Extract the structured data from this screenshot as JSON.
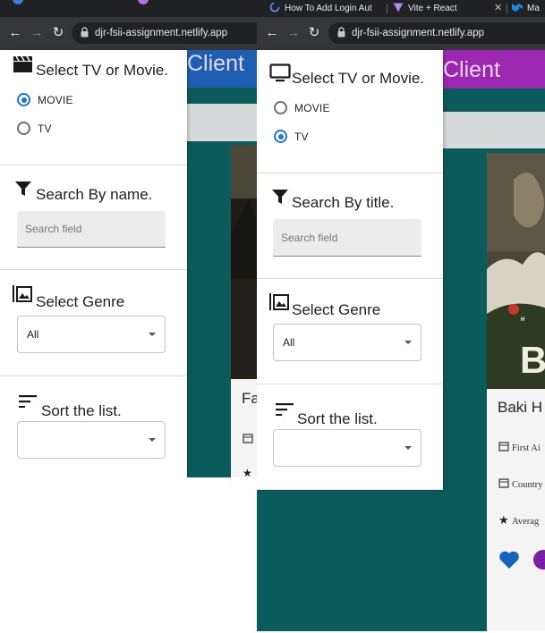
{
  "left_window": {
    "url": "djr-fsii-assignment.netlify.app",
    "app_title": "Client",
    "drawer": {
      "type_section": {
        "title": "Select TV or Movie.",
        "options": [
          "MOVIE",
          "TV"
        ],
        "selected": "MOVIE"
      },
      "search_section": {
        "title": "Search By name.",
        "placeholder": "Search field"
      },
      "genre_section": {
        "title": "Select Genre",
        "value": "All"
      },
      "sort_section": {
        "title": "Sort the list.",
        "value": ""
      }
    },
    "card": {
      "title_fragment": "Fa"
    }
  },
  "right_window": {
    "tabs": [
      {
        "title": "How To Add Login Aut"
      },
      {
        "title": "Vite + React"
      },
      {
        "title": "Ma"
      }
    ],
    "url": "djr-fsii-assignment.netlify.app",
    "app_title": "Client",
    "drawer": {
      "type_section": {
        "title": "Select TV or Movie.",
        "options": [
          "MOVIE",
          "TV"
        ],
        "selected": "TV"
      },
      "search_section": {
        "title": "Search By title.",
        "placeholder": "Search field"
      },
      "genre_section": {
        "title": "Select Genre",
        "value": "All"
      },
      "sort_section": {
        "title": "Sort the list.",
        "value": ""
      }
    },
    "card": {
      "title": "Baki H",
      "poster_text": "B",
      "poster_small_text": "H",
      "lines": [
        "First Ai",
        "Country",
        "Averag"
      ]
    }
  },
  "colors": {
    "accent": "#1976d2",
    "appbar_purple": "#9c27b0",
    "appbar_blue": "#1e5eb0",
    "teal_bg": "#0b5b5c",
    "chrome_dark": "#202124"
  }
}
